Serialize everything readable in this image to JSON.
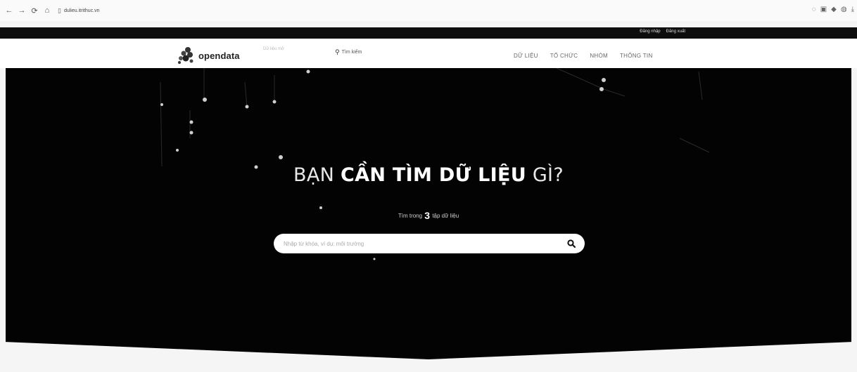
{
  "browser": {
    "url": "dulieu.itrithuc.vn",
    "back": "←",
    "forward": "→",
    "reload": "⟳",
    "home": "⌂"
  },
  "topbar": {
    "login": "Đăng nhập",
    "register": "Đăng xuất"
  },
  "header": {
    "logo": "opendata",
    "logo_sub": "Dữ liệu mở",
    "search": "Tìm kiếm",
    "menu": [
      "DỮ LIỆU",
      "TỔ CHỨC",
      "NHÓM",
      "THÔNG TIN"
    ]
  },
  "hero": {
    "title_prefix": "BẠN ",
    "title_bold": "CẦN TÌM DỮ LIỆU",
    "title_suffix": " GÌ?",
    "sub_before": "Tìm trong ",
    "sub_count": "3",
    "sub_after": " tập dữ liệu",
    "search_placeholder": "Nhập từ khóa, ví dụ: môi trường"
  },
  "colors": {
    "hero_bg": "#030303",
    "header_bg": "#ffffff",
    "topbar_bg": "#0d0d0d"
  }
}
